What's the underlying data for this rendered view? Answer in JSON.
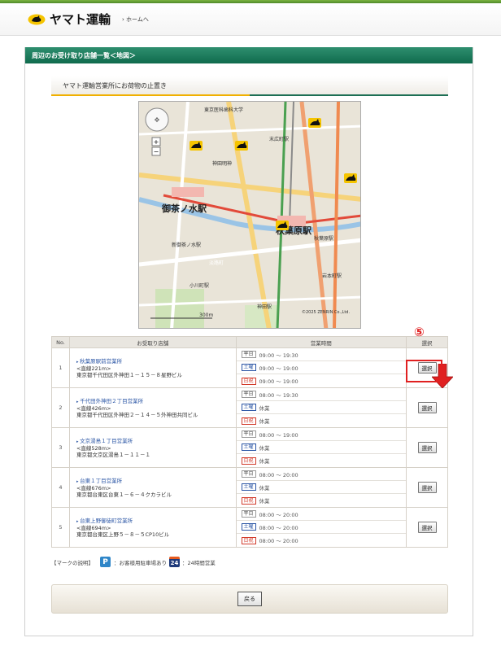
{
  "header": {
    "logo_text": "ヤマト運輸",
    "home_link": "› ホームへ"
  },
  "panel": {
    "title": "周辺のお受け取り店舗一覧＜地図＞",
    "subtitle": "ヤマト運輸営業所にお荷物の止置き"
  },
  "map": {
    "labels": {
      "tokyo_medical": "東京医科歯科大学",
      "station_ochanomizu": "御茶ノ水駅",
      "station_akihabara": "秋葉原駅",
      "station_akihabara_small": "秋葉原駅",
      "suehirocho": "末広町駅",
      "kanda_myojin": "神田明神",
      "shin_ochanomizu": "新御茶ノ水駅",
      "ogawamachi": "小川町駅",
      "kanda": "神田駅",
      "iwamotocho": "岩本町駅",
      "awajicho": "淡路町",
      "copyright": "©2025 ZENRIN Co.,Ltd."
    },
    "scale": "300m"
  },
  "table": {
    "headers": {
      "no": "No.",
      "store": "お受取り店舗",
      "hours": "営業時間",
      "select": "選択"
    },
    "day_labels": {
      "weekday": "平日",
      "saturday": "土曜",
      "sunday": "日祝"
    },
    "select_label": "選択",
    "rows": [
      {
        "no": "1",
        "name": "秋葉原駅前営業所",
        "distance": "<直線221m>",
        "address": "東京都千代田区外神田１－１５－８星野ビル",
        "weekday": "09:00 〜 19:30",
        "saturday": "09:00 〜 19:00",
        "sunday": "09:00 〜 19:00"
      },
      {
        "no": "2",
        "name": "千代田外神田２丁目営業所",
        "distance": "<直線426m>",
        "address": "東京都千代田区外神田２－１４－５外神田共同ビル",
        "weekday": "08:00 〜 19:30",
        "saturday": "休業",
        "sunday": "休業"
      },
      {
        "no": "3",
        "name": "文京湯島１丁目営業所",
        "distance": "<直線528m>",
        "address": "東京都文京区湯島１－１１－１",
        "weekday": "08:00 〜 19:00",
        "saturday": "休業",
        "sunday": "休業"
      },
      {
        "no": "4",
        "name": "台東１丁目営業所",
        "distance": "<直線676m>",
        "address": "東京都台東区台東１－６－４クカラビル",
        "weekday": "08:00 〜 20:00",
        "saturday": "休業",
        "sunday": "休業"
      },
      {
        "no": "5",
        "name": "台東上野御徒町営業所",
        "distance": "<直線694m>",
        "address": "東京都台東区上野５－８－５CP10ビル",
        "weekday": "08:00 〜 20:00",
        "saturday": "08:00 〜 20:00",
        "sunday": "08:00 〜 20:00"
      }
    ]
  },
  "annotation": {
    "step": "⑤"
  },
  "legend": {
    "prefix": "【マークの説明】",
    "p_badge": "P",
    "p_text": "：お客様用駐車場あり",
    "badge_24": "24",
    "text_24": "：24時間営業"
  },
  "footer": {
    "back_label": "戻る"
  },
  "colors": {
    "panel_title": "#0f6b4d",
    "highlight": "#e02020",
    "link": "#2a55a5",
    "sunday": "#d23a2a"
  }
}
